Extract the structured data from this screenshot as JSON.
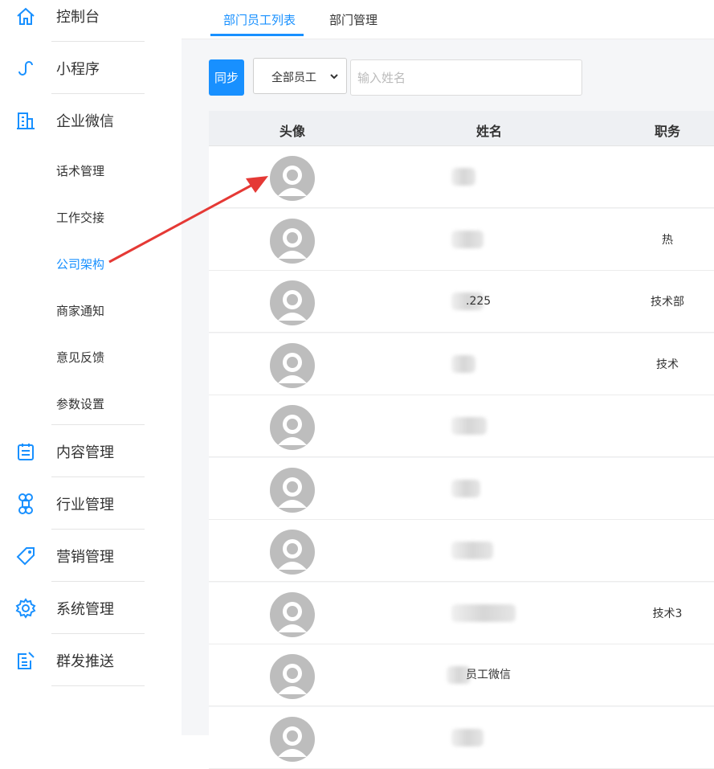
{
  "sidebar": {
    "main_items": [
      {
        "label": "控制台",
        "icon": "home-icon"
      },
      {
        "label": "小程序",
        "icon": "miniprogram-icon"
      },
      {
        "label": "企业微信",
        "icon": "building-icon"
      },
      {
        "label": "内容管理",
        "icon": "clipboard-icon"
      },
      {
        "label": "行业管理",
        "icon": "command-icon"
      },
      {
        "label": "营销管理",
        "icon": "tag-icon"
      },
      {
        "label": "系统管理",
        "icon": "gear-icon"
      },
      {
        "label": "群发推送",
        "icon": "edit-doc-icon"
      }
    ],
    "sub_items": [
      {
        "label": "话术管理"
      },
      {
        "label": "工作交接"
      },
      {
        "label": "公司架构",
        "active": true
      },
      {
        "label": "商家通知"
      },
      {
        "label": "意见反馈"
      },
      {
        "label": "参数设置"
      }
    ]
  },
  "tabs": [
    {
      "label": "部门员工列表",
      "active": true
    },
    {
      "label": "部门管理"
    }
  ],
  "toolbar": {
    "sync_label": "同步",
    "filter_value": "全部员工",
    "search_placeholder": "输入姓名"
  },
  "table": {
    "headers": {
      "avatar": "头像",
      "name": "姓名",
      "position": "职务"
    },
    "rows": [
      {
        "name": "",
        "position": ""
      },
      {
        "name": "",
        "position": "热"
      },
      {
        "name": ".225",
        "position": "技术部"
      },
      {
        "name": "",
        "position": "技术"
      },
      {
        "name": "",
        "position": ""
      },
      {
        "name": "",
        "position": ""
      },
      {
        "name": "",
        "position": ""
      },
      {
        "name": "",
        "position": "技术3"
      },
      {
        "name": "员工微信",
        "position": ""
      },
      {
        "name": "",
        "position": ""
      }
    ]
  },
  "colors": {
    "accent": "#1890ff",
    "avatar_gray": "#bdbdbd",
    "annotation_red": "#e53935"
  }
}
